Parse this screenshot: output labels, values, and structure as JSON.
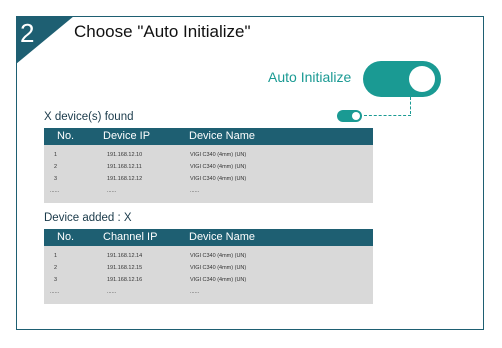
{
  "step": "2",
  "title": "Choose \"Auto Initialize\"",
  "auto_initialize_label": "Auto Initialize",
  "colors": {
    "brand": "#1e5f72",
    "accent": "#1a9a93",
    "table_bg": "#d9d9d9"
  },
  "found": {
    "label": "X device(s) found",
    "headers": [
      "No.",
      "Device IP",
      "Device Name"
    ],
    "rows": [
      [
        "1",
        "191.168.12.10",
        "VIGI C340 (4mm) (UN)"
      ],
      [
        "2",
        "191.168.12.11",
        "VIGI C340 (4mm) (UN)"
      ],
      [
        "3",
        "191.168.12.12",
        "VIGI C340 (4mm) (UN)"
      ],
      [
        "......",
        "......",
        "......"
      ]
    ]
  },
  "added": {
    "label": "Device added : X",
    "headers": [
      "No.",
      "Channel IP",
      "Device Name"
    ],
    "rows": [
      [
        "1",
        "191.168.12.14",
        "VIGI C340 (4mm) (UN)"
      ],
      [
        "2",
        "191.168.12.15",
        "VIGI C340 (4mm) (UN)"
      ],
      [
        "3",
        "191.168.12.16",
        "VIGI C340 (4mm) (UN)"
      ],
      [
        "......",
        "......",
        "......"
      ]
    ]
  }
}
